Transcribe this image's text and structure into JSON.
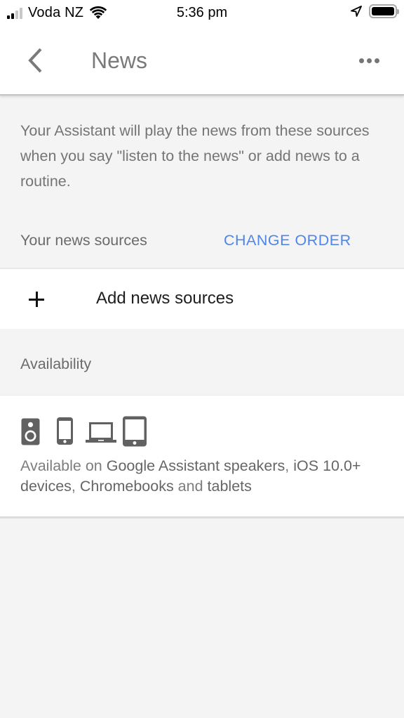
{
  "status_bar": {
    "carrier": "Voda NZ",
    "time": "5:36 pm",
    "signal_bars_filled": 2,
    "signal_bars_total": 4,
    "wifi": "wifi-icon",
    "location": "location-arrow-icon",
    "battery_level": 1.0
  },
  "app_bar": {
    "back_icon": "chevron-left-icon",
    "title": "News",
    "more_icon": "more-horizontal-icon"
  },
  "intro": {
    "text": "Your Assistant will play the news from these sources when you say \"listen to the news\" or add news to a routine."
  },
  "sources": {
    "header_label": "Your news sources",
    "change_order_label": "CHANGE ORDER",
    "add_icon": "plus-icon",
    "add_label": "Add news sources"
  },
  "availability": {
    "header_label": "Availability",
    "devices": [
      {
        "icon": "speaker-icon"
      },
      {
        "icon": "phone-icon"
      },
      {
        "icon": "laptop-icon"
      },
      {
        "icon": "tablet-icon"
      }
    ],
    "text_parts": [
      {
        "text": "Available on ",
        "emphasis": false
      },
      {
        "text": "Google Assistant speakers",
        "emphasis": true
      },
      {
        "text": ", ",
        "emphasis": false
      },
      {
        "text": "iOS 10.0+ devices",
        "emphasis": true
      },
      {
        "text": ", ",
        "emphasis": false
      },
      {
        "text": "Chromebooks",
        "emphasis": true
      },
      {
        "text": " and ",
        "emphasis": false
      },
      {
        "text": "tablets",
        "emphasis": true
      }
    ]
  },
  "colors": {
    "accent": "#4f86e8",
    "background": "#f4f4f4",
    "card": "#ffffff",
    "title": "#7a7a7a",
    "secondary_text": "#757575",
    "icon": "#616161"
  }
}
